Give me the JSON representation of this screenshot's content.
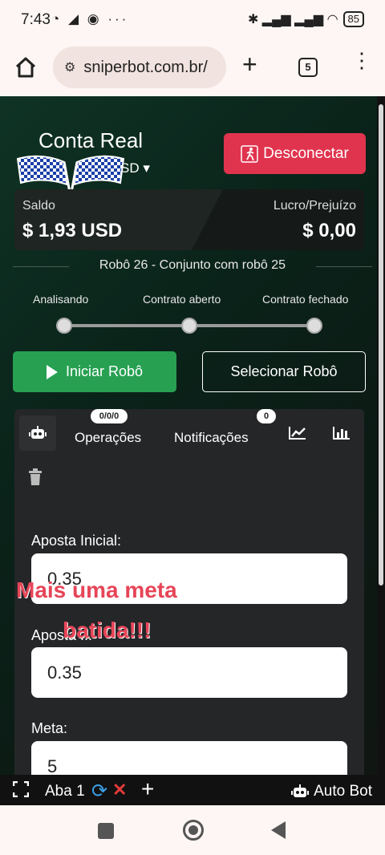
{
  "status": {
    "time": "7:43",
    "left_icons": "◔ ◢ ◉ ···",
    "right_icons": "✱ ▂▄▆ ▂▄▆ ◠",
    "battery": "85"
  },
  "browser": {
    "url": "sniperbot.com.br/",
    "tab_count": "5"
  },
  "account": {
    "title": "Conta Real",
    "currency": "SD ▾",
    "disconnect_label": "Desconectar",
    "saldo_label": "Saldo",
    "saldo_value": "$ 1,93 USD",
    "lucro_label": "Lucro/Prejuízo",
    "lucro_value": "$ 0,00"
  },
  "robot": {
    "title": "Robô 26 - Conjunto com robô 25",
    "steps": [
      "Analisando",
      "Contrato aberto",
      "Contrato fechado"
    ],
    "start_label": "Iniciar Robô",
    "select_label": "Selecionar Robô"
  },
  "panel": {
    "tabs": {
      "operacoes": "Operações",
      "operacoes_badge": "0/0/0",
      "notificacoes": "Notificações",
      "notificacoes_badge": "0"
    },
    "fields": [
      {
        "label": "Aposta Inicial:",
        "value": "0.35"
      },
      {
        "label": "Aposta ... ",
        "value": "0.35"
      },
      {
        "label": "Meta:",
        "value": "5"
      }
    ]
  },
  "overlay": {
    "line1": "Mais uma meta",
    "line2": "batida!!!"
  },
  "bottom_bar": {
    "tab_name": "Aba 1",
    "app_name": "Auto Bot"
  }
}
